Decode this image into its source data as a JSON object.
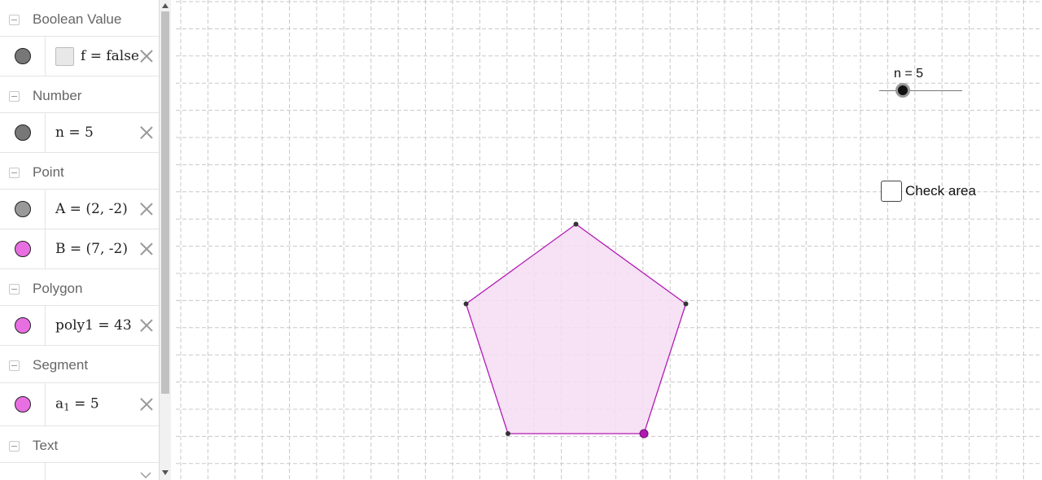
{
  "algebra": {
    "groups": [
      {
        "label": "Boolean Value",
        "rows": [
          {
            "text": "f = false",
            "color": "#777777",
            "type": "boolean"
          }
        ]
      },
      {
        "label": "Number",
        "rows": [
          {
            "text": "n = 5",
            "color": "#777777"
          }
        ]
      },
      {
        "label": "Point",
        "rows": [
          {
            "text": "A = (2, -2)",
            "color": "#999999"
          },
          {
            "text": "B = (7, -2)",
            "color": "#e86fe2"
          }
        ]
      },
      {
        "label": "Polygon",
        "rows": [
          {
            "text": "poly1 = 43",
            "color": "#e86fe2"
          }
        ]
      },
      {
        "label": "Segment",
        "rows": [
          {
            "text_main": "a",
            "text_sub": "1",
            "text_rest": " = 5",
            "color": "#e86fe2"
          }
        ]
      },
      {
        "label": "Text"
      }
    ]
  },
  "graphics": {
    "slider_label": "n = 5",
    "checkbox_label": "Check area",
    "polygon_fill": "#f5dcf3",
    "polygon_stroke": "#b21ab4",
    "point_B_color": "#b21ab4",
    "vertex_color": "#333333"
  }
}
